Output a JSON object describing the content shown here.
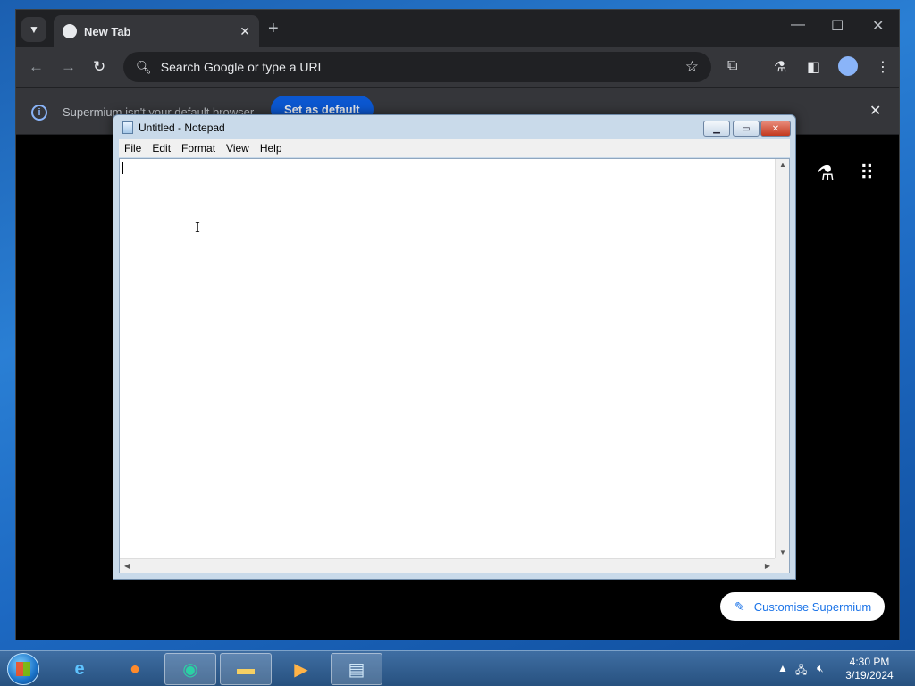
{
  "browser": {
    "tab_title": "New Tab",
    "omnibox_placeholder": "Search Google or type a URL",
    "infobar_text": "Supermium isn't your default browser",
    "set_default_label": "Set as default",
    "customise_label": "Customise Supermium"
  },
  "notepad": {
    "title": "Untitled - Notepad",
    "menu": [
      "File",
      "Edit",
      "Format",
      "View",
      "Help"
    ],
    "content": ""
  },
  "taskbar": {
    "time": "4:30 PM",
    "date": "3/19/2024",
    "apps": [
      "internet-explorer",
      "firefox",
      "supermium",
      "file-explorer",
      "media-player",
      "notepad"
    ]
  }
}
